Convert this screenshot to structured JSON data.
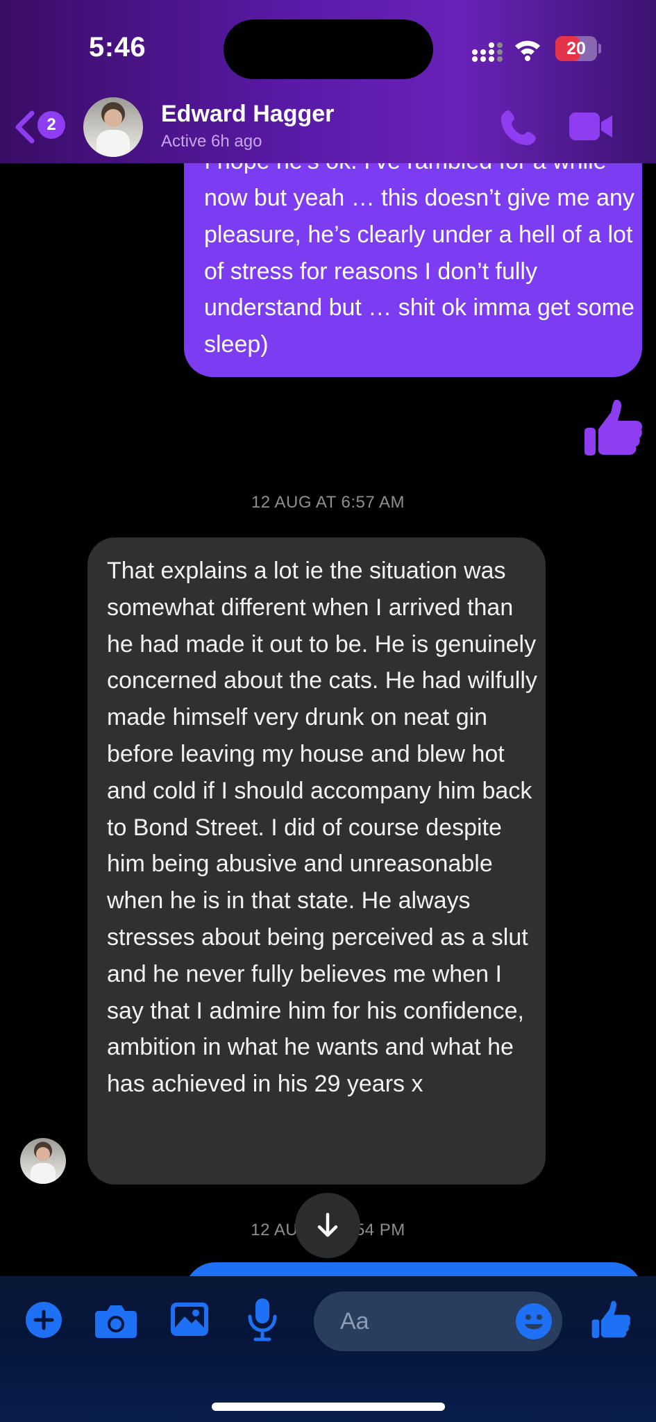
{
  "status_bar": {
    "time": "5:46",
    "battery": "20",
    "battery_level_percent": 20
  },
  "header": {
    "back_badge": "2",
    "contact_name": "Edward Hagger",
    "contact_status": "Active 6h ago",
    "icons": [
      "back-chevron-icon",
      "phone-icon",
      "video-camera-icon"
    ]
  },
  "messages": {
    "outgoing_text": "I hope he’s ok. I’ve rambled for a while now but yeah … this doesn’t give me any pleasure, he’s clearly under a hell of a lot of stress for reasons I don’t fully understand but … shit ok imma get some sleep)",
    "timestamp_1": "12 AUG AT 6:57 AM",
    "incoming_text": "That explains a lot ie the situation was somewhat different when I arrived than he had made it out to be. He is genuinely concerned about the cats. He had wilfully made himself very drunk on neat gin before leaving my house and blew hot and cold if I should accompany him back to Bond Street. I did of course despite him being abusive and unreasonable when he is in that state. He always stresses about being perceived as a slut and he never fully believes me when I say that I admire him for his confidence, ambition in what he wants and what he has achieved in his 29 years x",
    "timestamp_2": "12 AUG AT 6:54 PM"
  },
  "composer": {
    "placeholder": "Aa",
    "icons": [
      "plus-icon",
      "camera-icon",
      "gallery-icon",
      "microphone-icon",
      "emoji-icon",
      "thumbs-up-icon"
    ]
  },
  "colors": {
    "outgoing_bubble": "#7c3cf2",
    "incoming_bubble": "#303030",
    "accent_purple": "#8e3df0",
    "accent_blue": "#1e70f5",
    "battery_red": "#e5344a"
  }
}
